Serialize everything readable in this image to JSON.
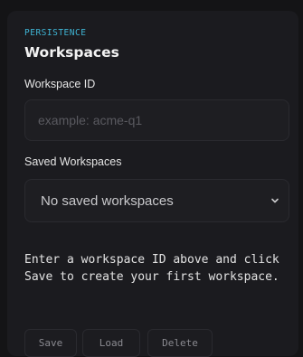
{
  "panel": {
    "eyebrow": "PERSISTENCE",
    "title": "Workspaces"
  },
  "workspace_id": {
    "label": "Workspace ID",
    "value": "",
    "placeholder": "example: acme-q1"
  },
  "saved_workspaces": {
    "label": "Saved Workspaces",
    "selected": "No saved workspaces",
    "icon": "chevron-down-icon"
  },
  "help_text": "Enter a workspace ID above and click Save to create your first workspace.",
  "buttons": {
    "save": "Save",
    "load": "Load",
    "delete": "Delete"
  },
  "colors": {
    "accent": "#3fb6d6",
    "background": "#141416",
    "panel": "#1b1b1f"
  }
}
